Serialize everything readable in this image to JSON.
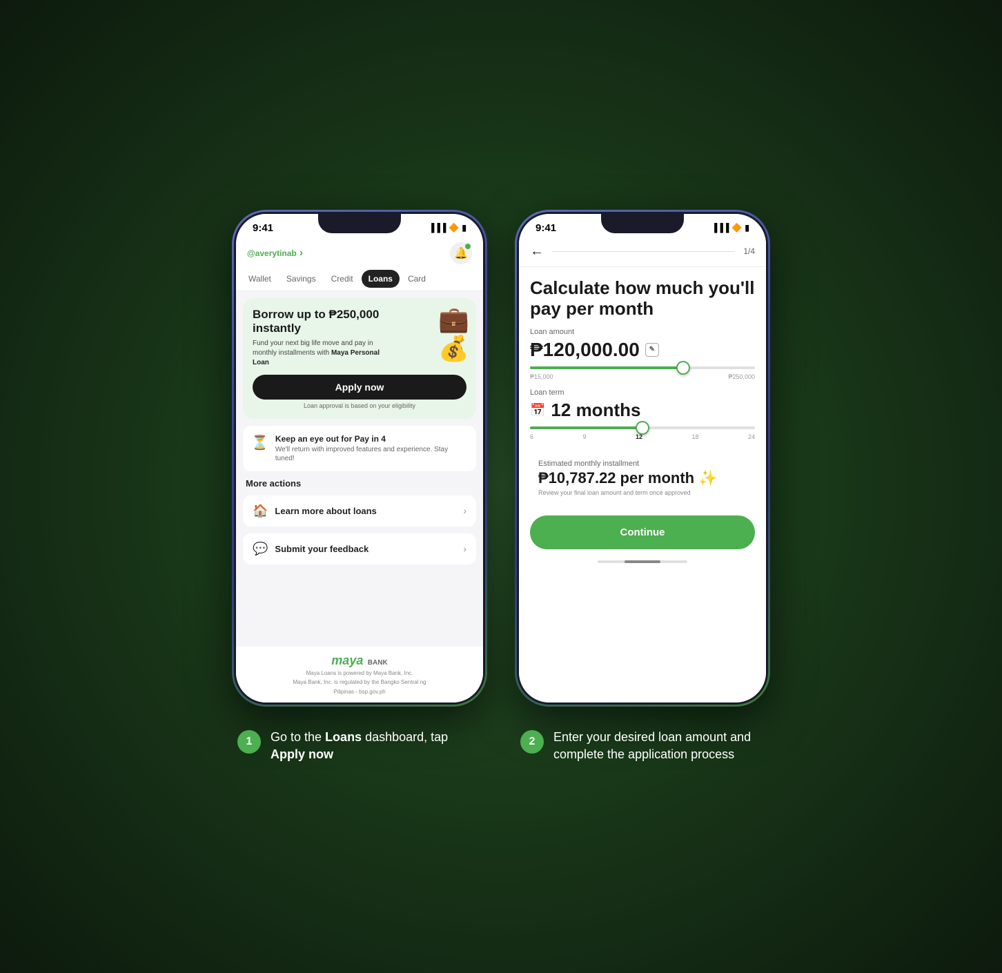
{
  "page": {
    "background": "#1a3a1a"
  },
  "phone1": {
    "status_time": "9:41",
    "username": "@averytinab",
    "chevron": "›",
    "tabs": [
      "Wallet",
      "Savings",
      "Credit",
      "Loans",
      "Card"
    ],
    "active_tab": "Loans",
    "hero": {
      "title": "Borrow up to ₱250,000 instantly",
      "subtitle": "Fund your next big life move and pay in monthly installments with",
      "subtitle_bold": "Maya Personal Loan",
      "emoji": "💼💰",
      "apply_btn": "Apply now",
      "approval_note": "Loan approval is based on your eligibility"
    },
    "pay4": {
      "icon": "⏳",
      "title": "Keep an eye out for Pay in 4",
      "subtitle": "We'll return with improved features and experience. Stay tuned!"
    },
    "more_actions": "More actions",
    "actions": [
      {
        "icon": "🏠",
        "text": "Learn more about loans"
      },
      {
        "icon": "💬",
        "text": "Submit your feedback"
      }
    ],
    "footer": {
      "brand": "maya",
      "bank": "BANK",
      "line1": "Maya Loans is powered by Maya Bank, Inc.",
      "line2": "Maya Bank, Inc. is regulated by the Bangko Sentral ng",
      "line3": "Pilipinas - bsp.gov.ph"
    }
  },
  "phone2": {
    "status_time": "9:41",
    "back_icon": "←",
    "progress": "1/4",
    "title": "Calculate how much you'll pay per month",
    "loan_amount_label": "Loan amount",
    "loan_amount": "₱120,000.00",
    "edit_icon": "✎",
    "slider1": {
      "min": "₱15,000",
      "max": "₱250,000",
      "fill_percent": 68
    },
    "loan_term_label": "Loan term",
    "loan_term_icon": "📅",
    "loan_term": "12 months",
    "slider2": {
      "labels": [
        "6",
        "9",
        "12",
        "18",
        "24"
      ],
      "fill_percent": 50,
      "active_label": "12"
    },
    "estimate": {
      "label": "Estimated monthly installment",
      "amount": "₱10,787.22",
      "per_month": "per month",
      "sparkle": "✨",
      "note": "Review your final loan amount and term once approved"
    },
    "continue_btn": "Continue"
  },
  "steps": [
    {
      "number": "1",
      "text_before": "Go to the ",
      "text_bold": "Loans",
      "text_after": " dashboard, tap ",
      "text_bold2": "Apply now"
    },
    {
      "number": "2",
      "text": "Enter your desired loan amount and complete the application process"
    }
  ]
}
